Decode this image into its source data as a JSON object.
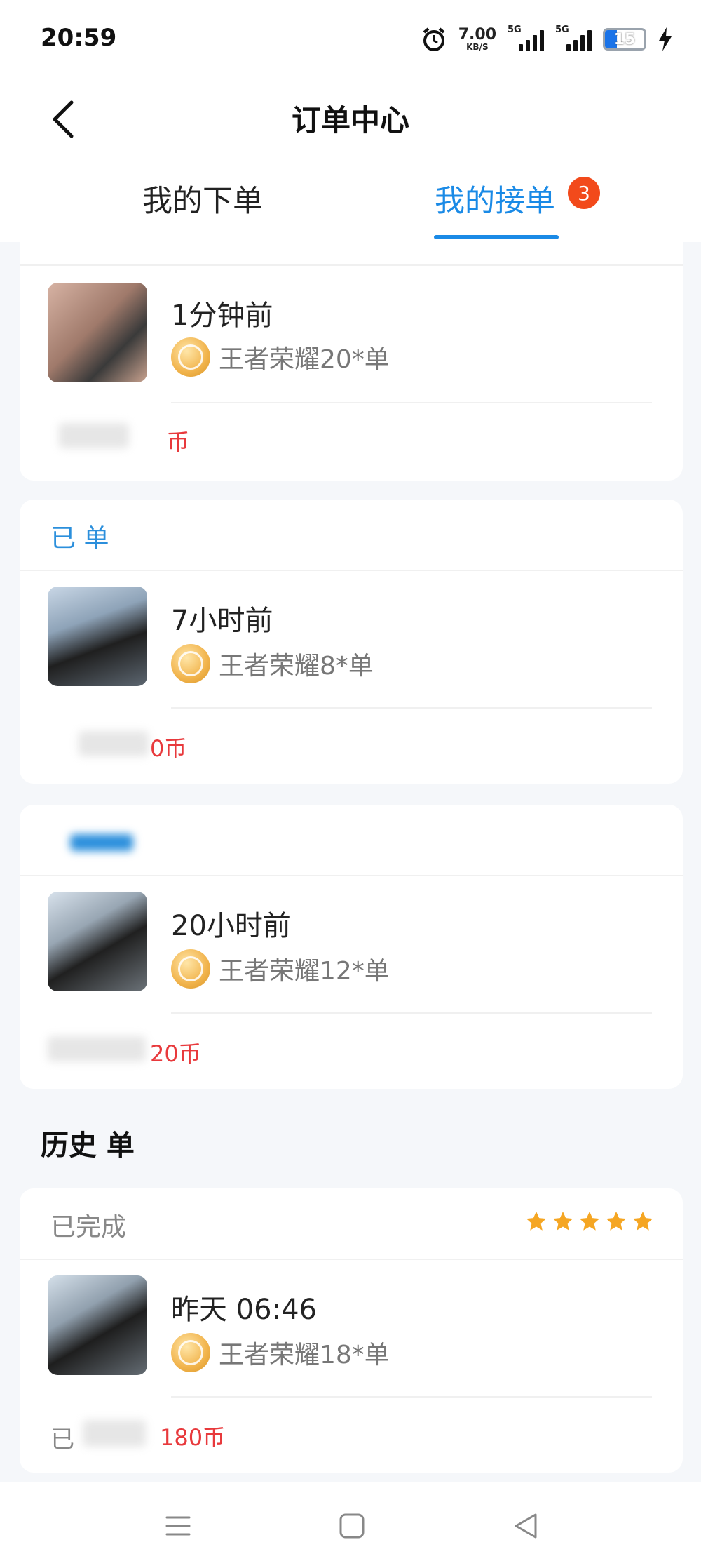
{
  "status_bar": {
    "time": "20:59",
    "net_speed_value": "7.00",
    "net_speed_unit": "KB/S",
    "sim1_label": "5G",
    "sim2_label": "5G",
    "battery_level": "15"
  },
  "header": {
    "title": "订单中心"
  },
  "tabs": [
    {
      "label": "我的下单"
    },
    {
      "label": "我的接单",
      "badge": "3"
    }
  ],
  "orders": [
    {
      "status": "",
      "time": "1分钟前",
      "game": "王者荣耀20*单",
      "price": "币"
    },
    {
      "status": "已 单",
      "time": "7小时前",
      "game": "王者荣耀8*单",
      "price": "0币"
    },
    {
      "status": "",
      "time": "20小时前",
      "game": "王者荣耀12*单",
      "price": "20币"
    }
  ],
  "history": {
    "title": "历史 单",
    "orders": [
      {
        "status": "已完成",
        "time": "昨天 06:46",
        "game": "王者荣耀18*单",
        "price": "180币",
        "prefix": "已",
        "rating_stars": 5
      }
    ]
  },
  "colors": {
    "accent": "#1a8ae6",
    "badge": "#f24a1b",
    "price": "#e8393c",
    "star": "#f5a623"
  }
}
